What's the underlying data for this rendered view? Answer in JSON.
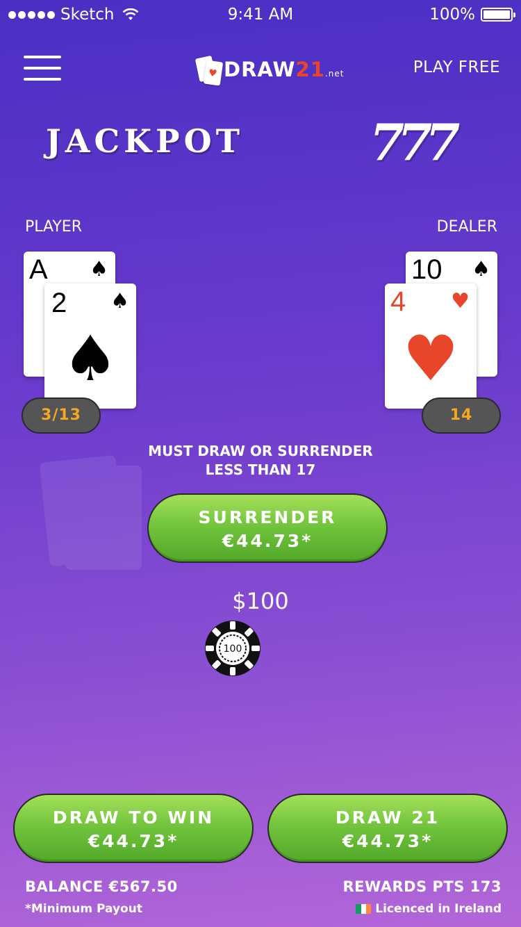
{
  "status_bar": {
    "carrier": "Sketch",
    "time": "9:41 AM",
    "battery": "100%"
  },
  "header": {
    "logo_text": "DRAW",
    "logo_21": "21",
    "logo_net": ".net",
    "play_free": "PLAY FREE"
  },
  "jackpot": {
    "text": "JACKPOT",
    "sevens": "777"
  },
  "player": {
    "label": "PLAYER",
    "cards": [
      {
        "rank": "A",
        "suit": "♠"
      },
      {
        "rank": "2",
        "suit": "♠"
      }
    ],
    "score": "3/13"
  },
  "dealer": {
    "label": "DEALER",
    "cards": [
      {
        "rank": "10",
        "suit": "♠"
      },
      {
        "rank": "4",
        "suit": "♥"
      }
    ],
    "score": "14"
  },
  "message": {
    "line1": "MUST DRAW OR SURRENDER",
    "line2": "LESS THAN 17"
  },
  "watermark": {
    "text": "DRAW21",
    "net": ".net"
  },
  "surrender": {
    "label": "SURRENDER",
    "amount": "€44.73*"
  },
  "bet": {
    "amount": "$100",
    "chip": "100"
  },
  "actions": {
    "draw_to_win": {
      "label": "DRAW TO WIN",
      "amount": "€44.73*"
    },
    "draw_21": {
      "label": "DRAW 21",
      "amount": "€44.73*"
    }
  },
  "footer": {
    "balance": "BALANCE €567.50",
    "min_payout": "*Minimum Payout",
    "rewards": "REWARDS PTS 173",
    "licence": "Licenced in Ireland"
  },
  "colors": {
    "green": "#6ec23a",
    "red_suit": "#e8462a",
    "score_text": "#f5a623"
  }
}
